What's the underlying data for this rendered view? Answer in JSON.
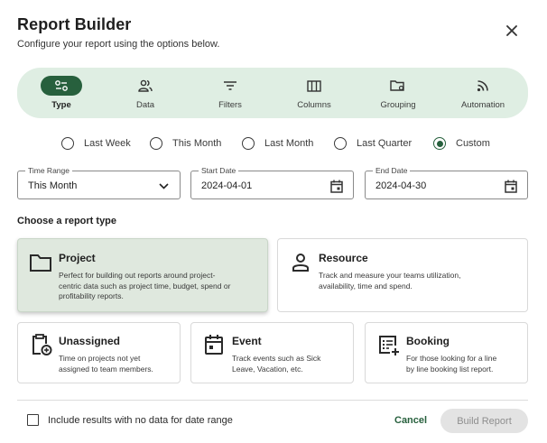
{
  "dialog": {
    "title": "Report Builder",
    "subtitle": "Configure your report using the options below.",
    "close_icon": "close-icon"
  },
  "tabs": [
    {
      "label": "Type",
      "icon": "type-toggle-icon",
      "active": true
    },
    {
      "label": "Data",
      "icon": "people-icon",
      "active": false
    },
    {
      "label": "Filters",
      "icon": "filter-icon",
      "active": false
    },
    {
      "label": "Columns",
      "icon": "columns-icon",
      "active": false
    },
    {
      "label": "Grouping",
      "icon": "folder-settings-icon",
      "active": false
    },
    {
      "label": "Automation",
      "icon": "rss-icon",
      "active": false
    }
  ],
  "date_range_options": [
    {
      "label": "Last Week",
      "checked": false
    },
    {
      "label": "This Month",
      "checked": false
    },
    {
      "label": "Last Month",
      "checked": false
    },
    {
      "label": "Last Quarter",
      "checked": false
    },
    {
      "label": "Custom",
      "checked": true
    }
  ],
  "fields": {
    "time_range": {
      "label": "Time Range",
      "value": "This Month"
    },
    "start_date": {
      "label": "Start Date",
      "value": "2024-04-01"
    },
    "end_date": {
      "label": "End Date",
      "value": "2024-04-30"
    }
  },
  "report_type_heading": "Choose a report type",
  "report_types": [
    {
      "title": "Project",
      "icon": "folder-icon",
      "selected": true,
      "desc_lines": [
        "Perfect for building out reports around project-",
        "centric data such as project time, budget, spend or",
        "profitability reports."
      ]
    },
    {
      "title": "Resource",
      "icon": "person-icon",
      "selected": false,
      "desc_lines": [
        "Track and measure your teams utilization,",
        "availability, time and spend."
      ]
    },
    {
      "title": "Unassigned",
      "icon": "clipboard-add-icon",
      "selected": false,
      "desc_lines": [
        "Time on projects not yet",
        "assigned to team members."
      ]
    },
    {
      "title": "Event",
      "icon": "calendar-event-icon",
      "selected": false,
      "desc_lines": [
        "Track events such as Sick",
        "Leave, Vacation, etc."
      ]
    },
    {
      "title": "Booking",
      "icon": "booking-list-icon",
      "selected": false,
      "desc_lines": [
        "For those looking for a line",
        "by line booking list report."
      ]
    }
  ],
  "footer": {
    "checkbox_label": "Include results with no data for date range",
    "checkbox_checked": false,
    "cancel_label": "Cancel",
    "build_label": "Build Report"
  },
  "colors": {
    "accent": "#27603d",
    "tab_bar_bg": "#dfeee3",
    "selected_card_bg": "#dfe8de",
    "disabled_button_bg": "#e3e3e3"
  }
}
